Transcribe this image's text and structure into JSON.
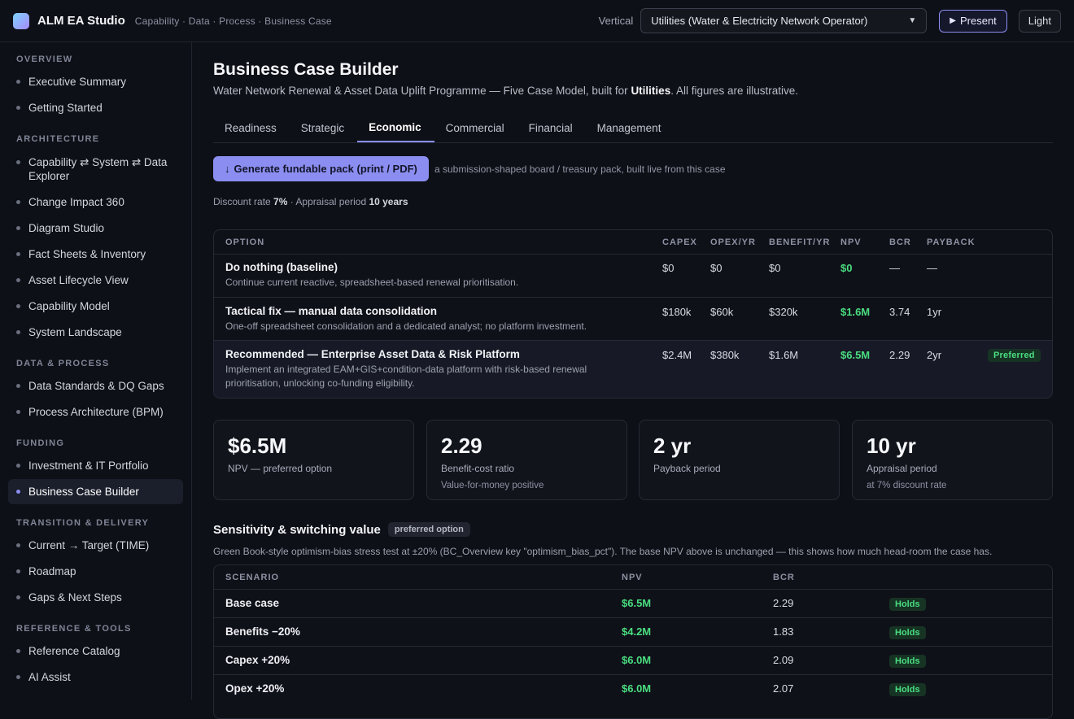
{
  "topbar": {
    "app_title": "ALM EA Studio",
    "app_subtitle": "Capability · Data · Process · Business Case",
    "vertical_label": "Vertical",
    "vertical_value": "Utilities (Water & Electricity Network Operator)",
    "present_label": "Present",
    "theme_label": "Light"
  },
  "sidebar": {
    "sections": [
      {
        "title": "OVERVIEW",
        "items": [
          "Executive Summary",
          "Getting Started"
        ]
      },
      {
        "title": "ARCHITECTURE",
        "items": [
          "Capability ⇄ System ⇄ Data Explorer",
          "Change Impact 360",
          "Diagram Studio",
          "Fact Sheets & Inventory",
          "Asset Lifecycle View",
          "Capability Model",
          "System Landscape"
        ]
      },
      {
        "title": "DATA & PROCESS",
        "items": [
          "Data Standards & DQ Gaps",
          "Process Architecture (BPM)"
        ]
      },
      {
        "title": "FUNDING",
        "items": [
          "Investment & IT Portfolio",
          "Business Case Builder"
        ]
      },
      {
        "title": "TRANSITION & DELIVERY",
        "items": [
          "Current → Target (TIME)",
          "Roadmap",
          "Gaps & Next Steps"
        ]
      },
      {
        "title": "REFERENCE & TOOLS",
        "items": [
          "Reference Catalog",
          "AI Assist"
        ]
      }
    ],
    "active_item": "Business Case Builder"
  },
  "page": {
    "title": "Business Case Builder",
    "subtitle_pre": "Water Network Renewal & Asset Data Uplift Programme — Five Case Model, built for ",
    "subtitle_bold": "Utilities",
    "subtitle_post": ". All figures are illustrative.",
    "tabs": [
      "Readiness",
      "Strategic",
      "Economic",
      "Commercial",
      "Financial",
      "Management"
    ],
    "active_tab": "Economic",
    "generate_label": "Generate fundable pack (print / PDF)",
    "generate_note": "a submission-shaped board / treasury pack, built live from this case",
    "discount_pre": "Discount rate ",
    "discount_rate": "7%",
    "discount_mid": " · Appraisal period ",
    "appraisal_period": "10 years"
  },
  "options_table": {
    "headers": [
      "OPTION",
      "CAPEX",
      "OPEX/YR",
      "BENEFIT/YR",
      "NPV",
      "BCR",
      "PAYBACK"
    ],
    "rows": [
      {
        "name": "Do nothing (baseline)",
        "desc": "Continue current reactive, spreadsheet-based renewal prioritisation.",
        "capex": "$0",
        "opex": "$0",
        "benefit": "$0",
        "npv": "$0",
        "bcr": "—",
        "payback": "—",
        "badge": ""
      },
      {
        "name": "Tactical fix — manual data consolidation",
        "desc": "One-off spreadsheet consolidation and a dedicated analyst; no platform investment.",
        "capex": "$180k",
        "opex": "$60k",
        "benefit": "$320k",
        "npv": "$1.6M",
        "bcr": "3.74",
        "payback": "1yr",
        "badge": ""
      },
      {
        "name": "Recommended — Enterprise Asset Data & Risk Platform",
        "desc": "Implement an integrated EAM+GIS+condition-data platform with risk-based renewal prioritisation, unlocking co-funding eligibility.",
        "capex": "$2.4M",
        "opex": "$380k",
        "benefit": "$1.6M",
        "npv": "$6.5M",
        "bcr": "2.29",
        "payback": "2yr",
        "badge": "Preferred"
      }
    ]
  },
  "kpis": [
    {
      "value": "$6.5M",
      "label": "NPV — preferred option",
      "note": ""
    },
    {
      "value": "2.29",
      "label": "Benefit-cost ratio",
      "note": "Value-for-money positive"
    },
    {
      "value": "2 yr",
      "label": "Payback period",
      "note": ""
    },
    {
      "value": "10 yr",
      "label": "Appraisal period",
      "note": "at 7% discount rate"
    }
  ],
  "sensitivity": {
    "title": "Sensitivity & switching value",
    "pill": "preferred option",
    "note": "Green Book-style optimism-bias stress test at ±20% (BC_Overview key \"optimism_bias_pct\"). The base NPV above is unchanged — this shows how much head-room the case has.",
    "headers": [
      "SCENARIO",
      "NPV",
      "BCR"
    ],
    "rows": [
      {
        "scenario": "Base case",
        "npv": "$6.5M",
        "bcr": "2.29",
        "status": "Holds"
      },
      {
        "scenario": "Benefits −20%",
        "npv": "$4.2M",
        "bcr": "1.83",
        "status": "Holds"
      },
      {
        "scenario": "Capex +20%",
        "npv": "$6.0M",
        "bcr": "2.09",
        "status": "Holds"
      },
      {
        "scenario": "Opex +20%",
        "npv": "$6.0M",
        "bcr": "2.07",
        "status": "Holds"
      }
    ]
  }
}
